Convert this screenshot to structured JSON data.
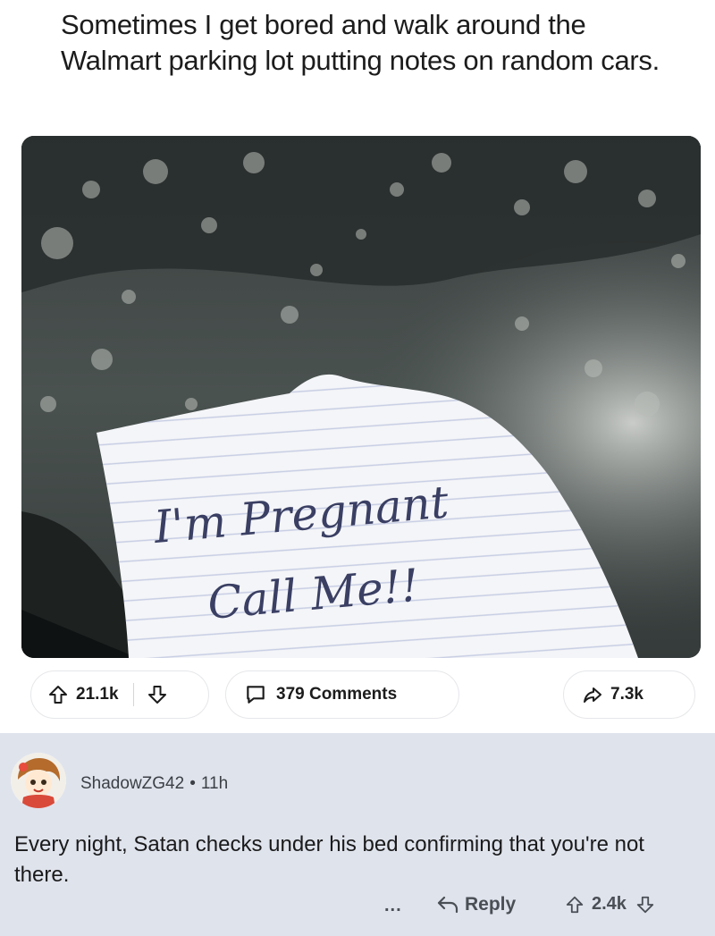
{
  "post": {
    "title": "Sometimes I get bored and walk around the Walmart parking lot putting notes on random cars.",
    "image": {
      "note_line1": "I'm Pregnant",
      "note_line2": "Call Me!!"
    },
    "upvotes": "21.1k",
    "comments_label": "379 Comments",
    "shares": "7.3k"
  },
  "comment": {
    "username": "ShadowZG42",
    "separator": "•",
    "age": "11h",
    "body": "Every night, Satan checks under his bed confirming that you're not there.",
    "more_label": "...",
    "reply_label": "Reply",
    "score": "2.4k"
  },
  "icons": {
    "upvote": "arrow-up-outline",
    "downvote": "arrow-down-outline",
    "comments": "speech-bubble",
    "share": "share-arrow",
    "reply": "reply-arrow"
  }
}
